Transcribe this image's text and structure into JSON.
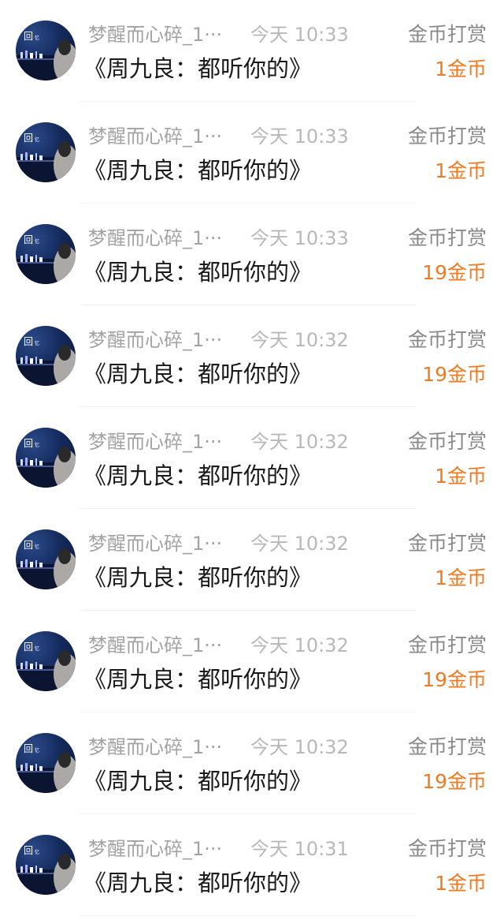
{
  "records": [
    {
      "name": "梦醒而心碎_1···",
      "time": "今天 10:33",
      "type": "金币打赏",
      "work": "《周九良：都听你的》",
      "amount": "1金币"
    },
    {
      "name": "梦醒而心碎_1···",
      "time": "今天 10:33",
      "type": "金币打赏",
      "work": "《周九良：都听你的》",
      "amount": "1金币"
    },
    {
      "name": "梦醒而心碎_1···",
      "time": "今天 10:33",
      "type": "金币打赏",
      "work": "《周九良：都听你的》",
      "amount": "19金币"
    },
    {
      "name": "梦醒而心碎_1···",
      "time": "今天 10:32",
      "type": "金币打赏",
      "work": "《周九良：都听你的》",
      "amount": "19金币"
    },
    {
      "name": "梦醒而心碎_1···",
      "time": "今天 10:32",
      "type": "金币打赏",
      "work": "《周九良：都听你的》",
      "amount": "1金币"
    },
    {
      "name": "梦醒而心碎_1···",
      "time": "今天 10:32",
      "type": "金币打赏",
      "work": "《周九良：都听你的》",
      "amount": "1金币"
    },
    {
      "name": "梦醒而心碎_1···",
      "time": "今天 10:32",
      "type": "金币打赏",
      "work": "《周九良：都听你的》",
      "amount": "19金币"
    },
    {
      "name": "梦醒而心碎_1···",
      "time": "今天 10:32",
      "type": "金币打赏",
      "work": "《周九良：都听你的》",
      "amount": "19金币"
    },
    {
      "name": "梦醒而心碎_1···",
      "time": "今天 10:31",
      "type": "金币打赏",
      "work": "《周九良：都听你的》",
      "amount": "1金币"
    }
  ],
  "colors": {
    "amount": "#f07a22",
    "name": "#a3a3a3",
    "time": "#b8b8b8",
    "type": "#8a8a8a",
    "work": "#1a1a1a"
  },
  "avatar_icon": "night-city-avatar-icon"
}
